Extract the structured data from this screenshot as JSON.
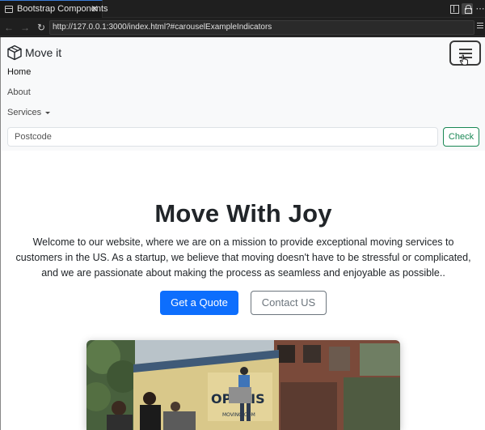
{
  "browser": {
    "tab_title": "Bootstrap Components",
    "tab_close": "✕",
    "url": "http://127.0.0.1:3000/index.html?#carouselExampleIndicators",
    "nav_back": "←",
    "nav_forward": "→",
    "nav_reload": "↻"
  },
  "navbar": {
    "brand": "Move it",
    "links": [
      "Home",
      "About",
      "Services"
    ],
    "postcode_placeholder": "Postcode",
    "check_label": "Check"
  },
  "hero": {
    "title": "Move With Joy",
    "description": "Welcome to our website, where we are on a mission to provide exceptional moving services to customers in the US. As a startup, we believe that moving doesn't have to be stressful or complicated, and we are passionate about making the process as seamless and enjoyable as possible..",
    "primary_button": "Get a Quote",
    "secondary_button": "Contact US"
  },
  "carousel": {
    "image_alt_partial_text": "OPOLIS",
    "image_url_text": "MOVING.COM"
  },
  "colors": {
    "primary": "#0d6efd",
    "success": "#198754",
    "secondary": "#6c757d",
    "navbar_bg": "#f8f9fa"
  }
}
